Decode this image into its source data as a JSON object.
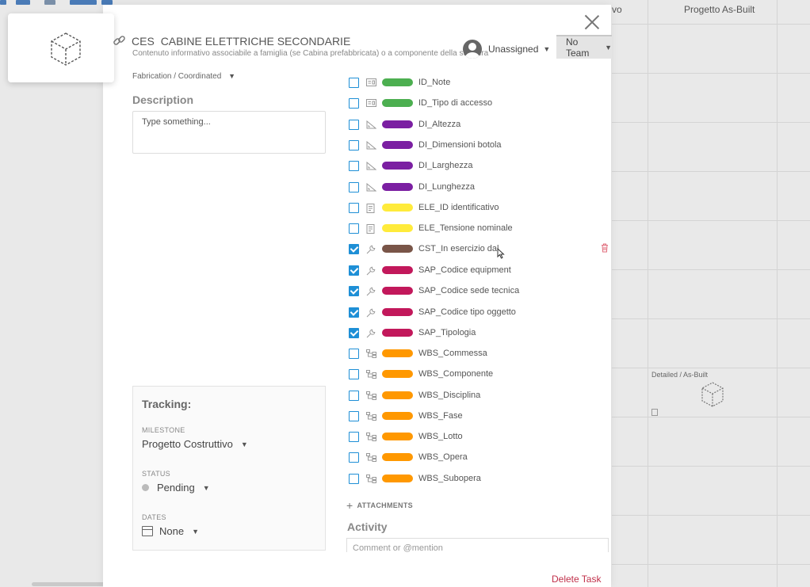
{
  "board": {
    "col_headers": [
      "vo",
      "Progetto As-Built"
    ],
    "card_label": "Detailed / As-Built"
  },
  "task": {
    "category": "CES",
    "title": "CABINE ELETTRICHE SECONDARIE",
    "subtitle": "Contenuto informativo associabile a famiglia (se Cabina prefabbricata) o a componente della struttura",
    "assignee": "Unassigned",
    "team": "No Team",
    "workflow": "Fabrication / Coordinated",
    "description_label": "Description",
    "description_placeholder": "Type something..."
  },
  "tracking": {
    "title": "Tracking:",
    "milestone_label": "MILESTONE",
    "milestone": "Progetto Costruttivo",
    "status_label": "STATUS",
    "status": "Pending",
    "dates_label": "DATES",
    "dates": "None"
  },
  "parameters": [
    {
      "name": "ID_Note",
      "checked": false,
      "color": "#4caf50",
      "icon": "id-card-icon"
    },
    {
      "name": "ID_Tipo di accesso",
      "checked": false,
      "color": "#4caf50",
      "icon": "id-card-icon"
    },
    {
      "name": "DI_Altezza",
      "checked": false,
      "color": "#7b1fa2",
      "icon": "ruler-angle-icon"
    },
    {
      "name": "DI_Dimensioni botola",
      "checked": false,
      "color": "#7b1fa2",
      "icon": "ruler-angle-icon"
    },
    {
      "name": "DI_Larghezza",
      "checked": false,
      "color": "#7b1fa2",
      "icon": "ruler-angle-icon"
    },
    {
      "name": "DI_Lunghezza",
      "checked": false,
      "color": "#7b1fa2",
      "icon": "ruler-angle-icon"
    },
    {
      "name": "ELE_ID identificativo",
      "checked": false,
      "color": "#ffeb3b",
      "icon": "document-icon"
    },
    {
      "name": "ELE_Tensione nominale",
      "checked": false,
      "color": "#ffeb3b",
      "icon": "document-icon"
    },
    {
      "name": "CST_In esercizio dal",
      "checked": true,
      "color": "#795548",
      "icon": "wrench-icon"
    },
    {
      "name": "SAP_Codice equipment",
      "checked": true,
      "color": "#c2185b",
      "icon": "wrench-icon"
    },
    {
      "name": "SAP_Codice sede tecnica",
      "checked": true,
      "color": "#c2185b",
      "icon": "wrench-icon"
    },
    {
      "name": "SAP_Codice tipo oggetto",
      "checked": true,
      "color": "#c2185b",
      "icon": "wrench-icon"
    },
    {
      "name": "SAP_Tipologia",
      "checked": true,
      "color": "#c2185b",
      "icon": "wrench-icon"
    },
    {
      "name": "WBS_Commessa",
      "checked": false,
      "color": "#ff9800",
      "icon": "hierarchy-icon"
    },
    {
      "name": "WBS_Componente",
      "checked": false,
      "color": "#ff9800",
      "icon": "hierarchy-icon"
    },
    {
      "name": "WBS_Disciplina",
      "checked": false,
      "color": "#ff9800",
      "icon": "hierarchy-icon"
    },
    {
      "name": "WBS_Fase",
      "checked": false,
      "color": "#ff9800",
      "icon": "hierarchy-icon"
    },
    {
      "name": "WBS_Lotto",
      "checked": false,
      "color": "#ff9800",
      "icon": "hierarchy-icon"
    },
    {
      "name": "WBS_Opera",
      "checked": false,
      "color": "#ff9800",
      "icon": "hierarchy-icon"
    },
    {
      "name": "WBS_Subopera",
      "checked": false,
      "color": "#ff9800",
      "icon": "hierarchy-icon"
    }
  ],
  "attachments_label": "ATTACHMENTS",
  "activity_label": "Activity",
  "comment_placeholder": "Comment or @mention",
  "delete_task_label": "Delete Task"
}
